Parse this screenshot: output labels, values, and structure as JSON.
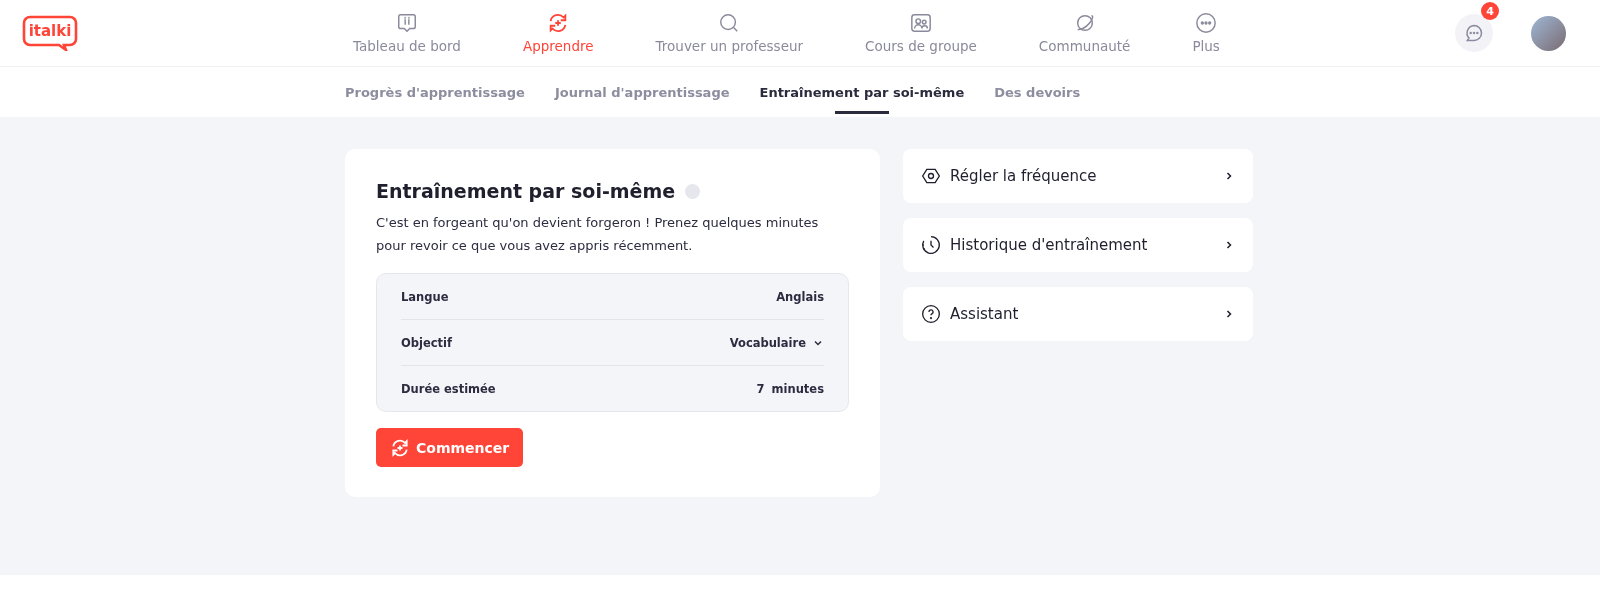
{
  "logo": "italki",
  "nav": [
    {
      "label": "Tableau de bord",
      "kind": "dashboard",
      "selected": false
    },
    {
      "label": "Apprendre",
      "kind": "learn",
      "selected": true
    },
    {
      "label": "Trouver un professeur",
      "kind": "search",
      "selected": false
    },
    {
      "label": "Cours de groupe",
      "kind": "group",
      "selected": false
    },
    {
      "label": "Communauté",
      "kind": "community",
      "selected": false
    },
    {
      "label": "Plus",
      "kind": "more",
      "selected": false
    }
  ],
  "messages_badge": "4",
  "subnav": [
    {
      "label": "Progrès d'apprentissage",
      "selected": false
    },
    {
      "label": "Journal d'apprentissage",
      "selected": false
    },
    {
      "label": "Entraînement par soi-même",
      "selected": true
    },
    {
      "label": "Des devoirs",
      "selected": false
    }
  ],
  "practice_card": {
    "title": "Entraînement par soi-même",
    "description": "C'est en forgeant qu'on devient forgeron ! Prenez quelques minutes pour revoir ce que vous avez appris récemment.",
    "settings": [
      {
        "label": "Langue",
        "kind": "text",
        "value": "Anglais"
      },
      {
        "label": "Objectif",
        "kind": "select",
        "value": "Vocabulaire"
      },
      {
        "label": "Durée estimée",
        "kind": "duration",
        "value": "7",
        "unit": "minutes"
      }
    ],
    "start_button": "Commencer"
  },
  "side_links": [
    {
      "label": "Régler la fréquence",
      "kind": "frequency"
    },
    {
      "label": "Historique d'entraînement",
      "kind": "history"
    },
    {
      "label": "Assistant",
      "kind": "help"
    }
  ]
}
